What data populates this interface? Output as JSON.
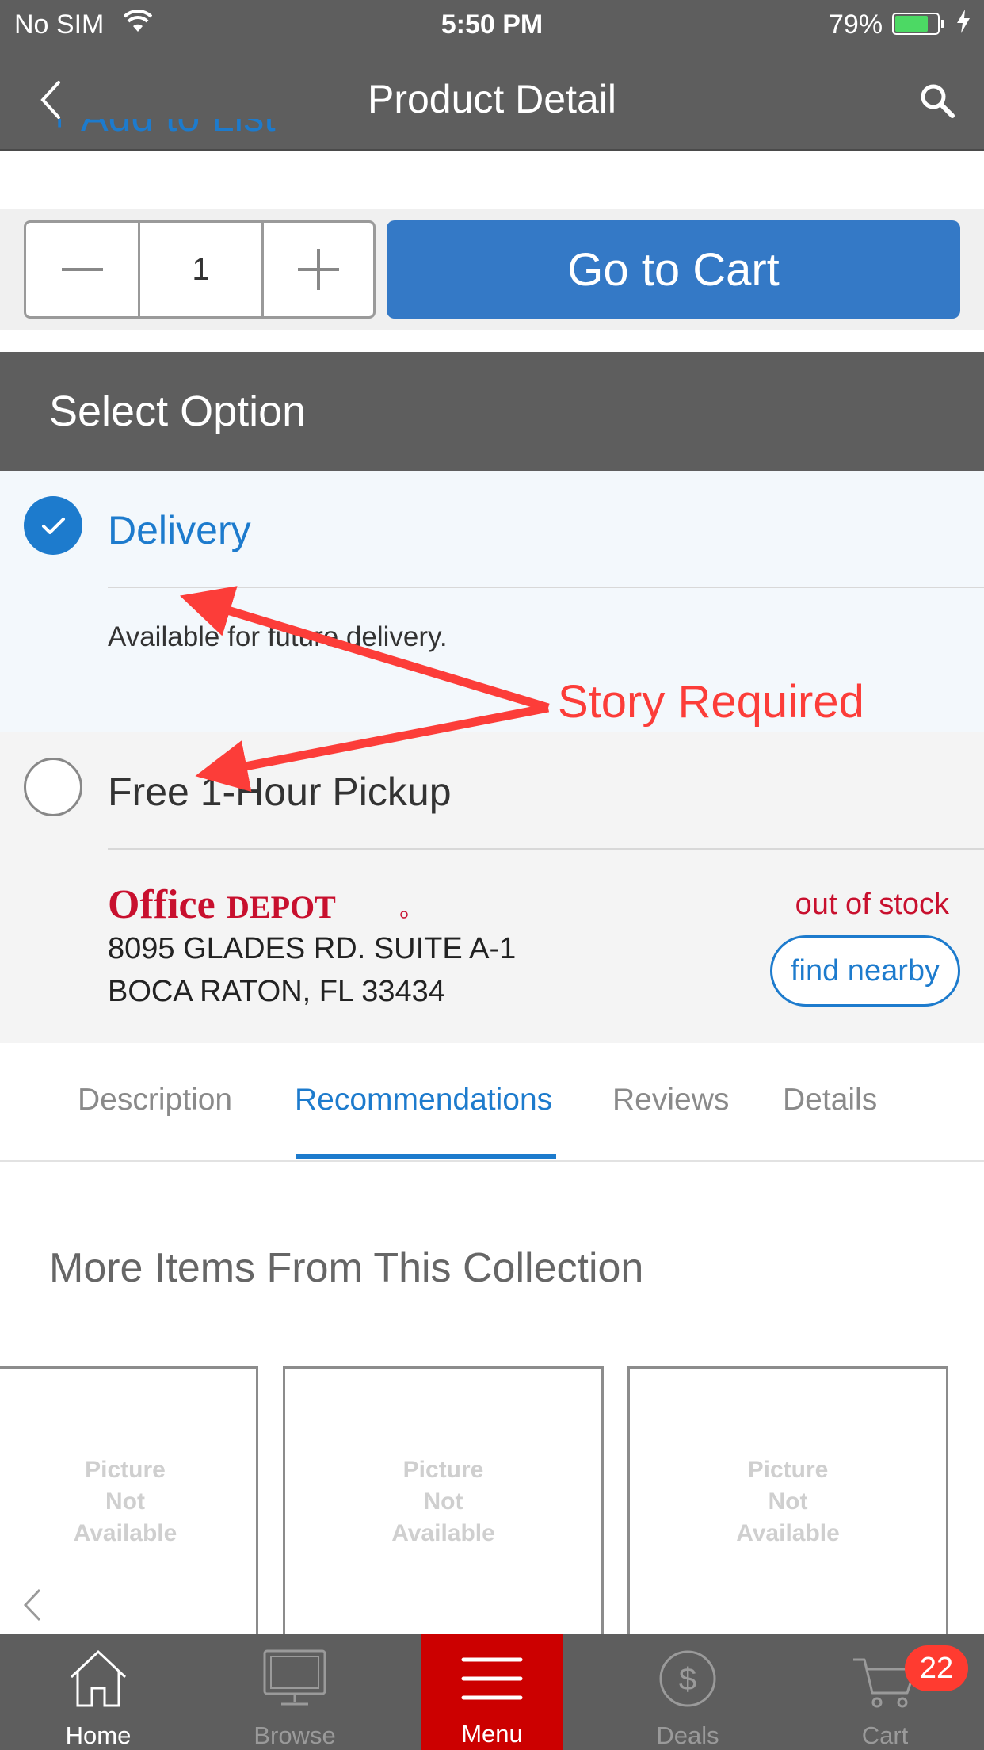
{
  "status_bar": {
    "carrier": "No SIM",
    "time": "5:50 PM",
    "battery_percent": "79%",
    "battery_level": 0.79
  },
  "nav": {
    "title": "Product Detail",
    "back_icon": "chevron-left-icon",
    "search_icon": "search-icon"
  },
  "add_to_list": {
    "label": "+ Add to List"
  },
  "quantity": {
    "value": "1",
    "minus_icon": "minus-icon",
    "plus_icon": "plus-icon"
  },
  "go_to_cart": {
    "label": "Go to Cart"
  },
  "select_option": {
    "title": "Select Option",
    "options": [
      {
        "label": "Delivery",
        "selected": true,
        "detail": "Available for future delivery."
      },
      {
        "label": "Free 1-Hour Pickup",
        "selected": false,
        "store_logo": "OFFICE DEPOT",
        "address_line1": "8095 GLADES RD. SUITE A-1",
        "address_line2": "BOCA RATON, FL 33434",
        "stock_status": "out of stock",
        "find_nearby": "find nearby"
      }
    ]
  },
  "tabs": [
    {
      "label": "Description",
      "active": false
    },
    {
      "label": "Recommendations",
      "active": true
    },
    {
      "label": "Reviews",
      "active": false
    },
    {
      "label": "Details",
      "active": false
    }
  ],
  "collection": {
    "title": "More Items From This Collection",
    "cards": [
      {
        "placeholder_line1": "Picture",
        "placeholder_line2": "Not",
        "placeholder_line3": "Available"
      },
      {
        "placeholder_line1": "Picture",
        "placeholder_line2": "Not",
        "placeholder_line3": "Available"
      },
      {
        "placeholder_line1": "Picture",
        "placeholder_line2": "Not",
        "placeholder_line3": "Available"
      }
    ]
  },
  "tab_bar": {
    "items": [
      {
        "label": "Home",
        "icon": "home-icon",
        "active": true
      },
      {
        "label": "Browse",
        "icon": "monitor-icon",
        "active": false
      },
      {
        "label": "Menu",
        "icon": "menu-icon",
        "active": false
      },
      {
        "label": "Deals",
        "icon": "dollar-icon",
        "active": false
      },
      {
        "label": "Cart",
        "icon": "cart-icon",
        "active": false
      }
    ],
    "cart_badge": "22"
  },
  "annotation": {
    "label": "Story Required",
    "color": "#fc3d39"
  },
  "colors": {
    "bar_gray": "#5e5e5e",
    "accent_blue": "#1d7bcd",
    "button_blue": "#3479c6",
    "menu_red": "#cc0000",
    "stock_red": "#c8102e"
  }
}
